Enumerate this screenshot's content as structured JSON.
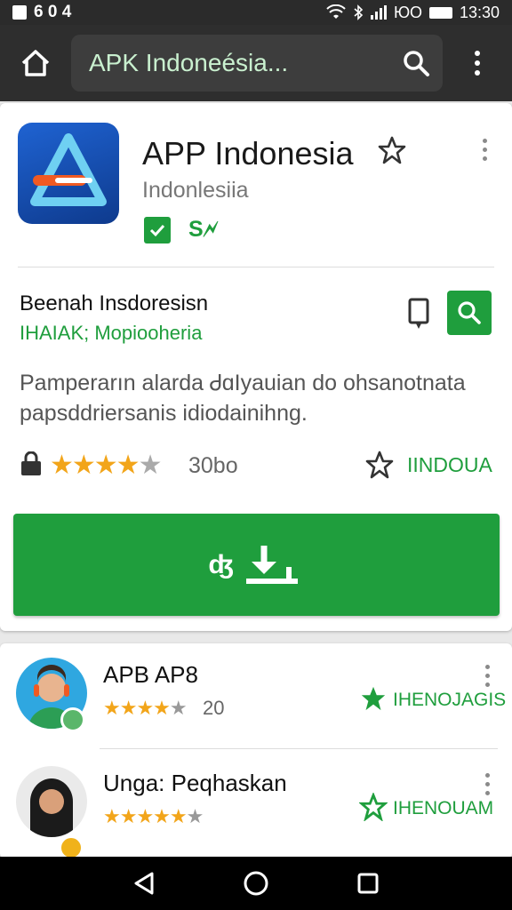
{
  "status_bar": {
    "left_text": "6 0 4",
    "time": "13:30",
    "carrier": "ЮО"
  },
  "toolbar": {
    "search_text": "APK Indoneésia..."
  },
  "app": {
    "title": "APP Indonesia",
    "subtitle": "Indonlesiia",
    "badge_text": "S🗲",
    "developer": "Beenah Insdoresisn",
    "developer_sub": "IHAIAK; Mopiooheria",
    "description": "Pamperarın alarda ᏧɑIyauian do ohsanotnata papsddriersanis idiodainihng.",
    "rating_stars": 4,
    "rating_count": "30bo",
    "wishlist_label": "IINDOUA",
    "install_label": "ʤ"
  },
  "list": [
    {
      "title": "APB AP8",
      "stars": 4,
      "rating": "20",
      "badge": "IHENOJAGIS"
    },
    {
      "title": "Unga: Peqhaskan",
      "stars": 4,
      "rating": "",
      "badge": "IHENOUAM"
    }
  ],
  "colors": {
    "accent_green": "#1f9e3d",
    "star_gold": "#f2a51a",
    "toolbar_dark": "#2e2e2e"
  }
}
